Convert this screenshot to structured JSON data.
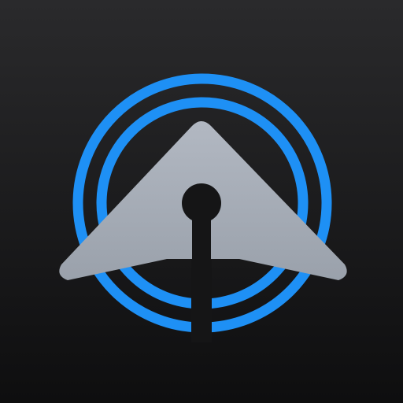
{
  "icon": {
    "name": "radar-arrow-app-icon",
    "elements": [
      "outer-ring-icon",
      "inner-ring-icon",
      "arrow-pointer-icon",
      "pivot-hole-icon",
      "stem-slot-icon"
    ]
  },
  "colors": {
    "background_top": "#2a2a2c",
    "background_bottom": "#0e0e0f",
    "ring_blue": "#1e90f5",
    "arrow_gray": "#a9b0bb",
    "arrow_shadow": "#8c929b",
    "cutout": "#151516"
  }
}
